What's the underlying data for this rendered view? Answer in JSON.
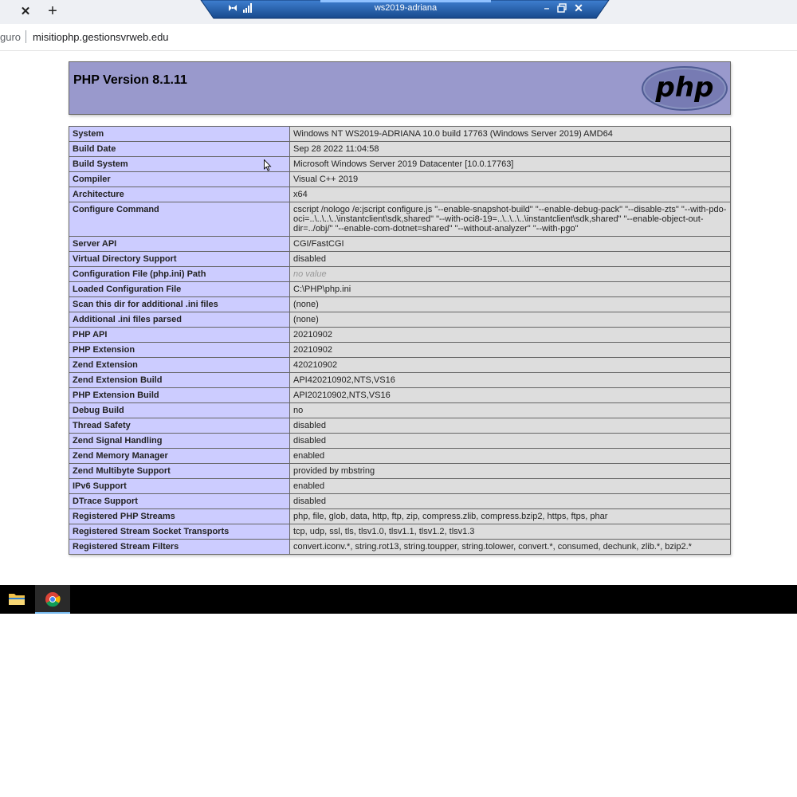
{
  "browser": {
    "tab_close_glyph": "✕",
    "new_tab_glyph": "+",
    "security_label": "guro",
    "url": "misitiophp.gestionsvrweb.edu"
  },
  "remote_bar": {
    "title": "ws2019-adriana",
    "bar_color": "#1f5fae"
  },
  "php": {
    "version_title": "PHP Version 8.1.11",
    "logo_text": "php",
    "header_color": "#9999cc",
    "key_color": "#ccccff",
    "value_color": "#dddddd",
    "rows": [
      {
        "key": "System",
        "value": "Windows NT WS2019-ADRIANA 10.0 build 17763 (Windows Server 2019) AMD64"
      },
      {
        "key": "Build Date",
        "value": "Sep 28 2022 11:04:58"
      },
      {
        "key": "Build System",
        "value": "Microsoft Windows Server 2019 Datacenter [10.0.17763]"
      },
      {
        "key": "Compiler",
        "value": "Visual C++ 2019"
      },
      {
        "key": "Architecture",
        "value": "x64"
      },
      {
        "key": "Configure Command",
        "value": "cscript /nologo /e:jscript configure.js \"--enable-snapshot-build\" \"--enable-debug-pack\" \"--disable-zts\" \"--with-pdo-oci=..\\..\\..\\..\\instantclient\\sdk,shared\" \"--with-oci8-19=..\\..\\..\\..\\instantclient\\sdk,shared\" \"--enable-object-out-dir=../obj/\" \"--enable-com-dotnet=shared\" \"--without-analyzer\" \"--with-pgo\""
      },
      {
        "key": "Server API",
        "value": "CGI/FastCGI"
      },
      {
        "key": "Virtual Directory Support",
        "value": "disabled"
      },
      {
        "key": "Configuration File (php.ini) Path",
        "value": "no value"
      },
      {
        "key": "Loaded Configuration File",
        "value": "C:\\PHP\\php.ini"
      },
      {
        "key": "Scan this dir for additional .ini files",
        "value": "(none)"
      },
      {
        "key": "Additional .ini files parsed",
        "value": "(none)"
      },
      {
        "key": "PHP API",
        "value": "20210902"
      },
      {
        "key": "PHP Extension",
        "value": "20210902"
      },
      {
        "key": "Zend Extension",
        "value": "420210902"
      },
      {
        "key": "Zend Extension Build",
        "value": "API420210902,NTS,VS16"
      },
      {
        "key": "PHP Extension Build",
        "value": "API20210902,NTS,VS16"
      },
      {
        "key": "Debug Build",
        "value": "no"
      },
      {
        "key": "Thread Safety",
        "value": "disabled"
      },
      {
        "key": "Zend Signal Handling",
        "value": "disabled"
      },
      {
        "key": "Zend Memory Manager",
        "value": "enabled"
      },
      {
        "key": "Zend Multibyte Support",
        "value": "provided by mbstring"
      },
      {
        "key": "IPv6 Support",
        "value": "enabled"
      },
      {
        "key": "DTrace Support",
        "value": "disabled"
      },
      {
        "key": "Registered PHP Streams",
        "value": "php, file, glob, data, http, ftp, zip, compress.zlib, compress.bzip2, https, ftps, phar"
      },
      {
        "key": "Registered Stream Socket Transports",
        "value": "tcp, udp, ssl, tls, tlsv1.0, tlsv1.1, tlsv1.2, tlsv1.3"
      },
      {
        "key": "Registered Stream Filters",
        "value": "convert.iconv.*, string.rot13, string.toupper, string.tolower, convert.*, consumed, dechunk, zlib.*, bzip2.*"
      }
    ]
  },
  "taskbar": {
    "apps": [
      {
        "name": "File Explorer",
        "icon": "folder-icon"
      },
      {
        "name": "Google Chrome",
        "icon": "chrome-icon",
        "active": true
      }
    ]
  }
}
